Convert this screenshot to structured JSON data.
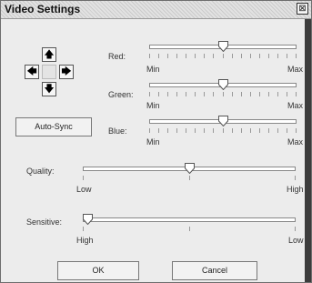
{
  "window": {
    "title": "Video Settings",
    "close_glyph": "⊠"
  },
  "dpad": {
    "up": "🡅",
    "down": "🡇",
    "left": "🡄",
    "right": "🡆"
  },
  "auto_sync_label": "Auto-Sync",
  "color_sliders": [
    {
      "label": "Red:",
      "min_label": "Min",
      "max_label": "Max",
      "value": 0.5
    },
    {
      "label": "Green:",
      "min_label": "Min",
      "max_label": "Max",
      "value": 0.5
    },
    {
      "label": "Blue:",
      "min_label": "Min",
      "max_label": "Max",
      "value": 0.5
    }
  ],
  "quality": {
    "label": "Quality:",
    "min_label": "Low",
    "max_label": "High",
    "value": 0.5
  },
  "sensitive": {
    "label": "Sensitive:",
    "min_label": "High",
    "max_label": "Low",
    "value": 0.0
  },
  "buttons": {
    "ok": "OK",
    "cancel": "Cancel"
  }
}
